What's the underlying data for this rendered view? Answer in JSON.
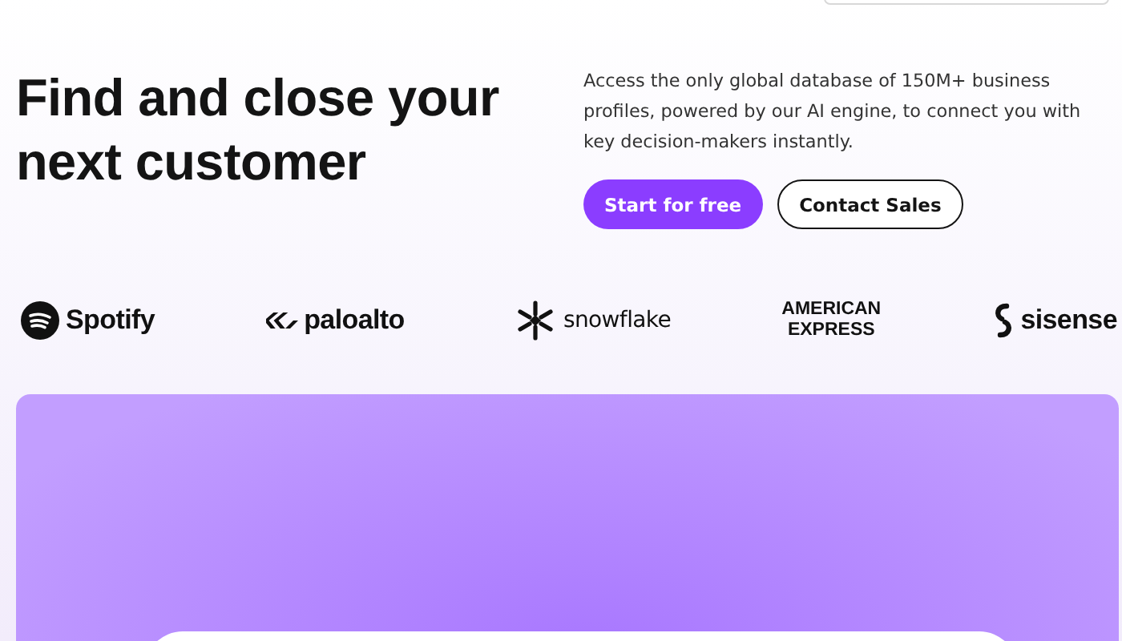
{
  "hero": {
    "headline": "Find and close your next customer",
    "description": "Access the only global database of 150M+ business profiles, powered by our AI engine, to connect you with key decision-makers instantly.",
    "buttons": [
      {
        "kind": "primary",
        "label": "Start for free"
      },
      {
        "kind": "outline",
        "label": "Contact Sales"
      }
    ]
  },
  "logos": [
    {
      "kind": "circle-waves",
      "lines": [
        "Spotify"
      ]
    },
    {
      "kind": "stripes",
      "lines": [
        "paloalto"
      ]
    },
    {
      "kind": "flake",
      "lines": [
        "snowflake"
      ]
    },
    {
      "kind": "none",
      "lines": [
        "AMERICAN",
        "EXPRESS"
      ]
    },
    {
      "kind": "hook",
      "lines": [
        "sisense"
      ]
    }
  ]
}
